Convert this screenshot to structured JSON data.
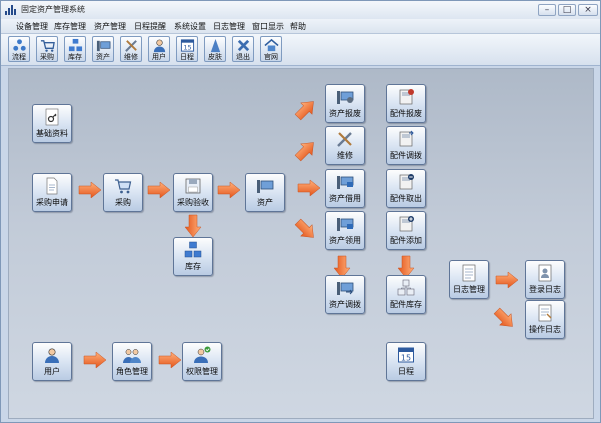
{
  "window": {
    "title": "固定资产管理系统"
  },
  "menu": [
    "设备管理",
    "库存管理",
    "资产管理",
    "日程提醒",
    "系统设置",
    "日志管理",
    "窗口显示",
    "帮助"
  ],
  "toolbar": [
    {
      "label": "流程",
      "icon": "flow-icon"
    },
    {
      "label": "采购",
      "icon": "cart-icon"
    },
    {
      "label": "库存",
      "icon": "inventory-icon"
    },
    {
      "label": "资产",
      "icon": "asset-icon"
    },
    {
      "label": "维修",
      "icon": "repair-icon"
    },
    {
      "label": "用户",
      "icon": "user-icon"
    },
    {
      "label": "日程",
      "icon": "calendar-icon"
    },
    {
      "label": "皮肤",
      "icon": "skin-icon"
    },
    {
      "label": "退出",
      "icon": "exit-icon"
    },
    {
      "label": "官网",
      "icon": "home-icon"
    }
  ],
  "flow": {
    "basic_info": "基础资料",
    "purchase_request": "采购申请",
    "purchase": "采购",
    "purchase_acceptance": "采购验收",
    "inventory": "库存",
    "asset": "资产",
    "asset_scrap": "资产报废",
    "repair": "维修",
    "asset_borrow": "资产借用",
    "asset_use": "资产领用",
    "asset_transfer": "资产调拨",
    "part_scrap": "配件报废",
    "part_transfer": "配件调拨",
    "part_outbound": "配件取出",
    "part_add": "配件添加",
    "part_inventory": "配件库存",
    "log_management": "日志管理",
    "login_log": "登录日志",
    "operation_log": "操作日志",
    "user": "用户",
    "role_management": "角色管理",
    "permission_management": "权限管理",
    "schedule": "日程",
    "calendar_day": "15"
  },
  "colors": {
    "arrow": "#f07a35",
    "node_border": "#5f7597",
    "canvas": "#c2cbd8"
  }
}
